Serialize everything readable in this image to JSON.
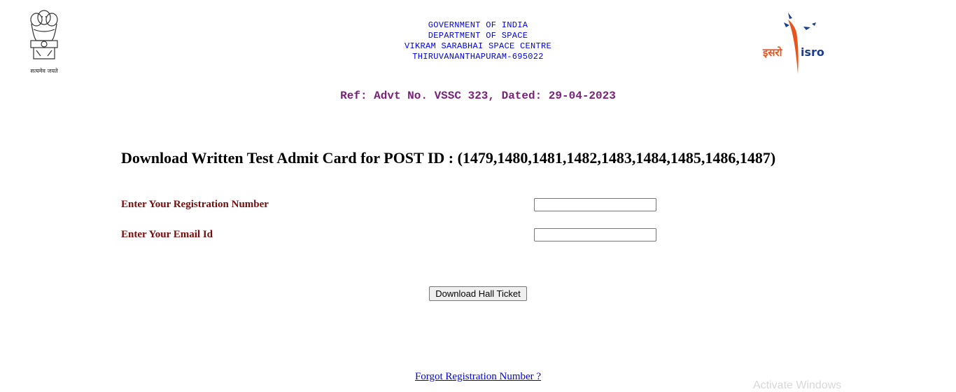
{
  "emblem": {
    "caption": "सत्यमेव जयते"
  },
  "header": {
    "lines": [
      "GOVERNMENT OF INDIA",
      "DEPARTMENT OF SPACE",
      "VIKRAM SARABHAI SPACE CENTRE",
      "THIRUVANANTHAPURAM-695022"
    ]
  },
  "isro_logo": {
    "hindi": "इसरो",
    "english": "isro",
    "color": "#e8541c"
  },
  "ref": "Ref: Advt No. VSSC 323, Dated: 29-04-2023",
  "title": "Download Written Test Admit Card for POST ID : (1479,1480,1481,1482,1483,1484,1485,1486,1487)",
  "form": {
    "registration_label": "Enter Your Registration Number",
    "registration_value": "",
    "email_label": "Enter Your Email Id",
    "email_value": ""
  },
  "download_button": "Download Hall Ticket",
  "forgot_link": "Forgot Registration Number ?",
  "watermark": "Activate Windows"
}
